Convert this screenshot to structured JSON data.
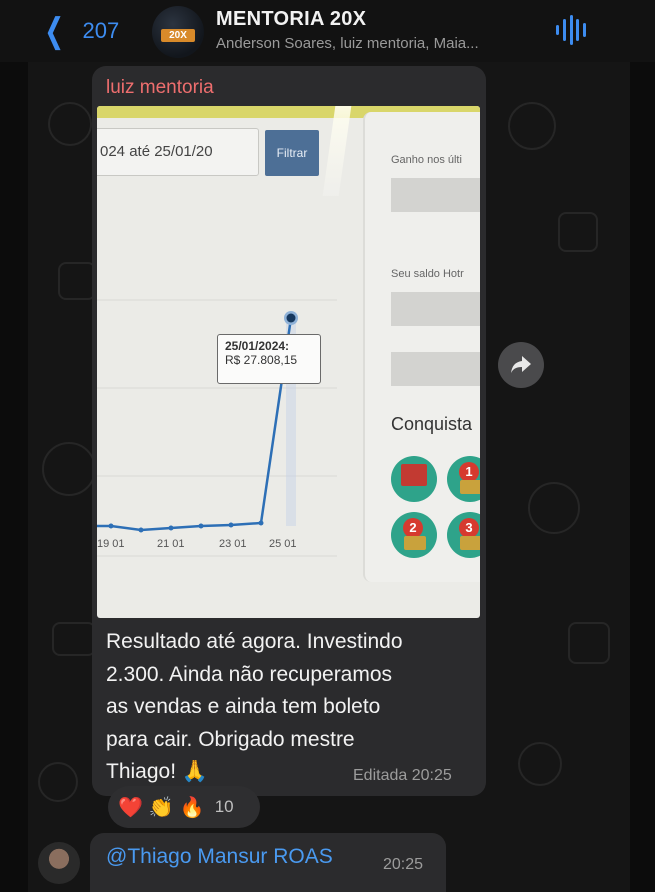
{
  "header": {
    "back_count": "207",
    "back_icon": "chevron-left-icon",
    "avatar_badge": "20X",
    "title": "MENTORIA 20X",
    "subtitle": "Anderson Soares, luiz mentoria, Maia...",
    "voice_icon": "voice-chat-icon",
    "accent_color": "#3d8cf0"
  },
  "message": {
    "sender": "luiz mentoria",
    "sender_color": "#ee6e6e",
    "photo": {
      "date_field": "024 até 25/01/20",
      "filter_button": "Filtrar",
      "tooltip_date": "25/01/2024:",
      "tooltip_value": "R$ 27.808,15",
      "x_ticks": [
        "19 01",
        "21 01",
        "23 01",
        "25 01"
      ],
      "right_labels": [
        "Ganho nos últi",
        "Seu saldo Hotr"
      ],
      "achievements_heading": "Conquista",
      "medal_numbers": [
        "1",
        "2",
        "3"
      ]
    },
    "text_lines": [
      "Resultado até agora. Investindo",
      "2.300. Ainda não recuperamos",
      "as vendas e ainda tem boleto",
      "para cair. Obrigado mestre",
      "Thiago! 🙏"
    ],
    "edited_label": "Editada",
    "time": "20:25",
    "reactions": [
      "❤️",
      "👏",
      "🔥"
    ],
    "reaction_count": "10",
    "share_icon": "share-forward-icon"
  },
  "message2": {
    "mention": "@Thiago Mansur ROAS",
    "time": "20:25"
  }
}
